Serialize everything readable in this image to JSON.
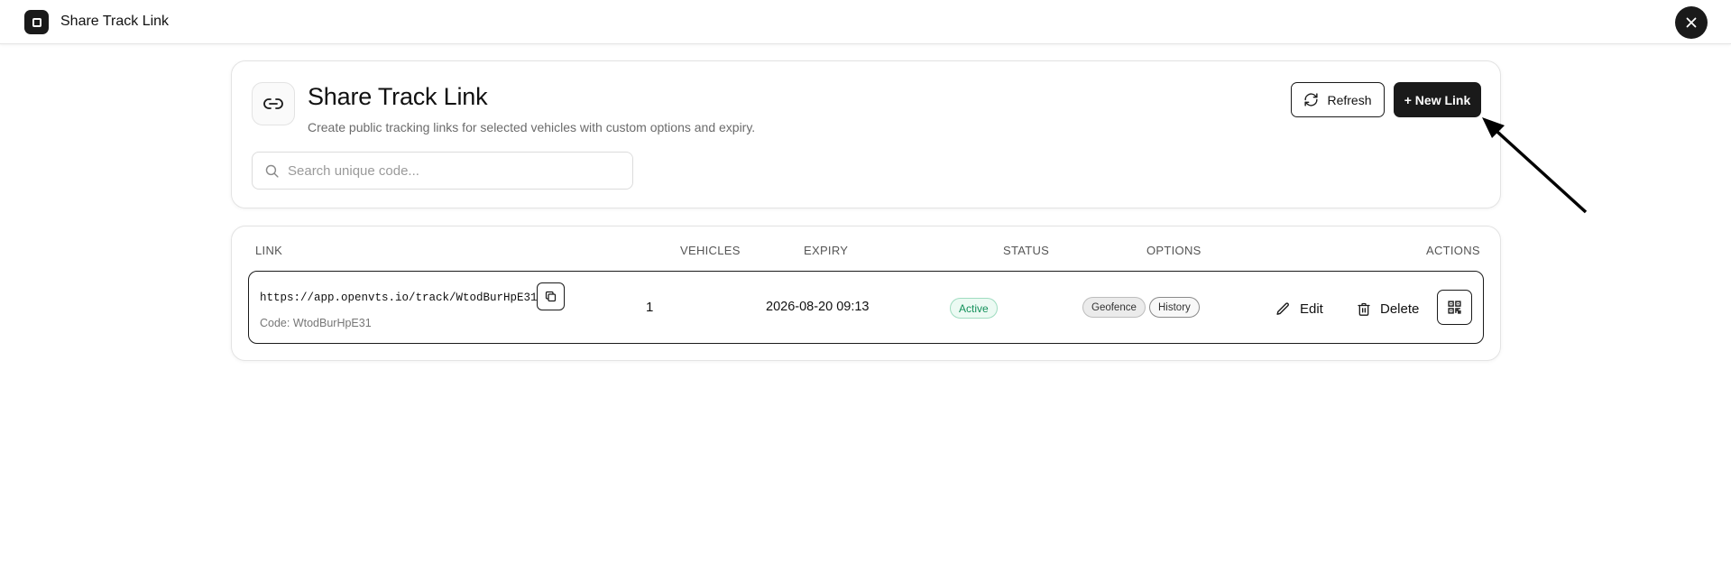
{
  "topbar": {
    "app_icon": "square-icon",
    "title": "Share Track Link",
    "close_icon": "close-icon"
  },
  "header": {
    "badge_icon": "link-icon",
    "title": "Share Track Link",
    "subtitle": "Create public tracking links for selected vehicles with custom options and expiry.",
    "refresh_label": "Refresh",
    "refresh_icon": "refresh-icon",
    "new_link_label": "+ New Link"
  },
  "search": {
    "placeholder": "Search unique code...",
    "value": "",
    "icon": "search-icon"
  },
  "table": {
    "columns": {
      "link": "LINK",
      "vehicles": "VEHICLES",
      "expiry": "EXPIRY",
      "status": "STATUS",
      "options": "OPTIONS",
      "actions": "ACTIONS"
    },
    "rows": [
      {
        "url": "https://app.openvts.io/track/WtodBurHpE31",
        "code": "Code: WtodBurHpE31",
        "vehicles": "1",
        "expiry": "2026-08-20 09:13",
        "status": "Active",
        "options": [
          "Geofence",
          "History"
        ],
        "edit_label": "Edit",
        "delete_label": "Delete"
      }
    ]
  },
  "colors": {
    "primary": "#1a1a1a",
    "status_active_text": "#13905a",
    "status_active_bg": "#ecfaf3",
    "muted_text": "#6b6b6b",
    "border": "#e3e3e3"
  }
}
